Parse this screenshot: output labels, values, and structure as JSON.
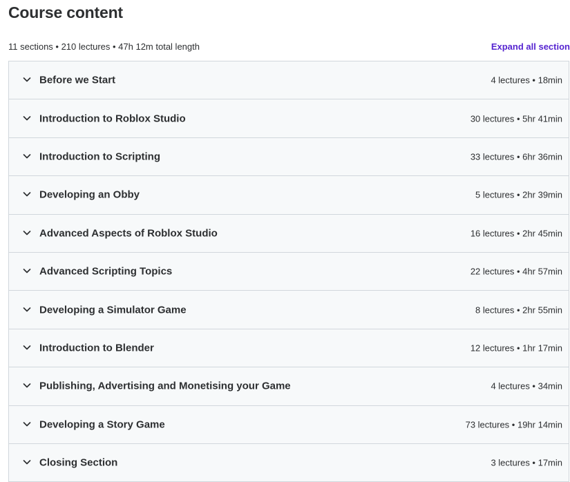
{
  "header": {
    "title": "Course content",
    "summary": "11 sections • 210 lectures • 47h 12m total length",
    "expand_all_label": "Expand all section"
  },
  "colors": {
    "accent": "#5624d0",
    "text": "#2d2f31",
    "row_bg": "#f7f9fa",
    "border": "#d1d7dc"
  },
  "sections": [
    {
      "title": "Before we Start",
      "meta": "4 lectures • 18min",
      "icon": "chevron-down-icon"
    },
    {
      "title": "Introduction to Roblox Studio",
      "meta": "30 lectures • 5hr 41min",
      "icon": "chevron-down-icon"
    },
    {
      "title": "Introduction to Scripting",
      "meta": "33 lectures • 6hr 36min",
      "icon": "chevron-down-icon"
    },
    {
      "title": "Developing an Obby",
      "meta": "5 lectures • 2hr 39min",
      "icon": "chevron-down-icon"
    },
    {
      "title": "Advanced Aspects of Roblox Studio",
      "meta": "16 lectures • 2hr 45min",
      "icon": "chevron-down-icon"
    },
    {
      "title": "Advanced Scripting Topics",
      "meta": "22 lectures • 4hr 57min",
      "icon": "chevron-down-icon"
    },
    {
      "title": "Developing a Simulator Game",
      "meta": "8 lectures • 2hr 55min",
      "icon": "chevron-down-icon"
    },
    {
      "title": "Introduction to Blender",
      "meta": "12 lectures • 1hr 17min",
      "icon": "chevron-down-icon"
    },
    {
      "title": "Publishing, Advertising and Monetising your Game",
      "meta": "4 lectures • 34min",
      "icon": "chevron-down-icon"
    },
    {
      "title": "Developing a Story Game",
      "meta": "73 lectures • 19hr 14min",
      "icon": "chevron-down-icon"
    },
    {
      "title": "Closing Section",
      "meta": "3 lectures • 17min",
      "icon": "chevron-down-icon"
    }
  ]
}
